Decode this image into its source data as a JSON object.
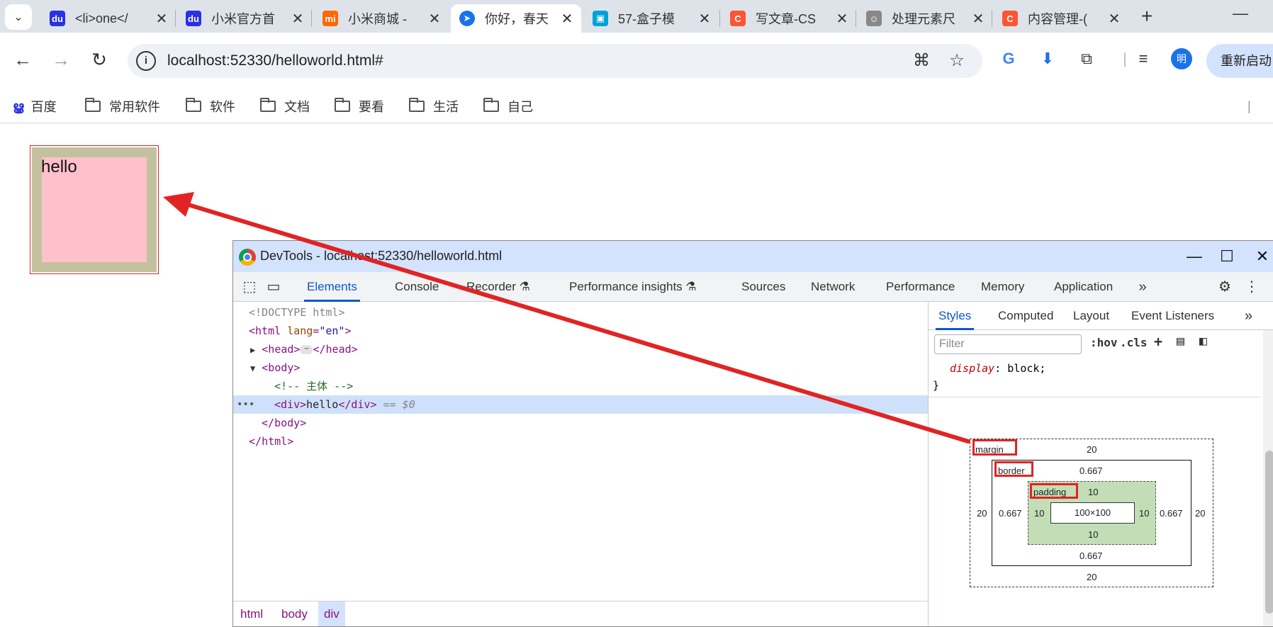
{
  "tabs": [
    {
      "title": "<li>one</",
      "favicon_color": "#2932e1",
      "favicon_text": "du"
    },
    {
      "title": "小米官方首",
      "favicon_color": "#2932e1",
      "favicon_text": "du"
    },
    {
      "title": "小米商城 -",
      "favicon_color": "#ff6700",
      "favicon_text": "mi"
    },
    {
      "title": "你好，春天",
      "favicon_color": "#1a73e8",
      "favicon_text": "➤"
    },
    {
      "title": "57-盒子模",
      "favicon_color": "#00a1d6",
      "favicon_text": "▣"
    },
    {
      "title": "写文章-CS",
      "favicon_color": "#fc5531",
      "favicon_text": "C"
    },
    {
      "title": "处理元素尺",
      "favicon_color": "#888888",
      "favicon_text": "☺"
    },
    {
      "title": "内容管理-(",
      "favicon_color": "#fc5531",
      "favicon_text": "C"
    }
  ],
  "browser": {
    "url": "localhost:52330/helloworld.html#",
    "restart_label": "重新启动",
    "profile_initial": "明"
  },
  "bookmarks": [
    "百度",
    "常用软件",
    "软件",
    "文档",
    "要看",
    "生活",
    "自己"
  ],
  "page": {
    "hello_text": "hello"
  },
  "devtools": {
    "title": "DevTools - localhost:52330/helloworld.html",
    "tabs": [
      "Elements",
      "Console",
      "Recorder",
      "Performance insights",
      "Sources",
      "Network",
      "Performance",
      "Memory",
      "Application"
    ],
    "dom": {
      "doctype": "<!DOCTYPE html>",
      "html_open": "html",
      "lang_attr": "lang",
      "lang_val": "\"en\"",
      "head": "head",
      "body": "body",
      "comment": "<!-- 主体 -->",
      "div": "div",
      "div_text": "hello",
      "eq": "== $0"
    },
    "crumbs": [
      "html",
      "body",
      "div"
    ],
    "side_tabs": [
      "Styles",
      "Computed",
      "Layout",
      "Event Listeners"
    ],
    "filter_placeholder": "Filter",
    "hov": ":hov",
    "cls": ".cls",
    "css": {
      "prop": "display",
      "value": "block;",
      "close": "}"
    },
    "box_model": {
      "margin_label": "margin",
      "border_label": "border",
      "padding_label": "padding",
      "margin": {
        "top": "20",
        "right": "20",
        "bottom": "20",
        "left": "20"
      },
      "border": {
        "top": "0.667",
        "right": "0.667",
        "bottom": "0.667",
        "left": "0.667"
      },
      "padding": {
        "top": "10",
        "right": "10",
        "bottom": "10",
        "left": "10"
      },
      "content": "100×100"
    }
  },
  "colors": {
    "highlight_red": "#e02424",
    "padding_green": "#c3deb7",
    "demo_border_olive": "#c4c29e",
    "demo_pink": "#ffc0cb",
    "accent_blue": "#0b57d0"
  }
}
